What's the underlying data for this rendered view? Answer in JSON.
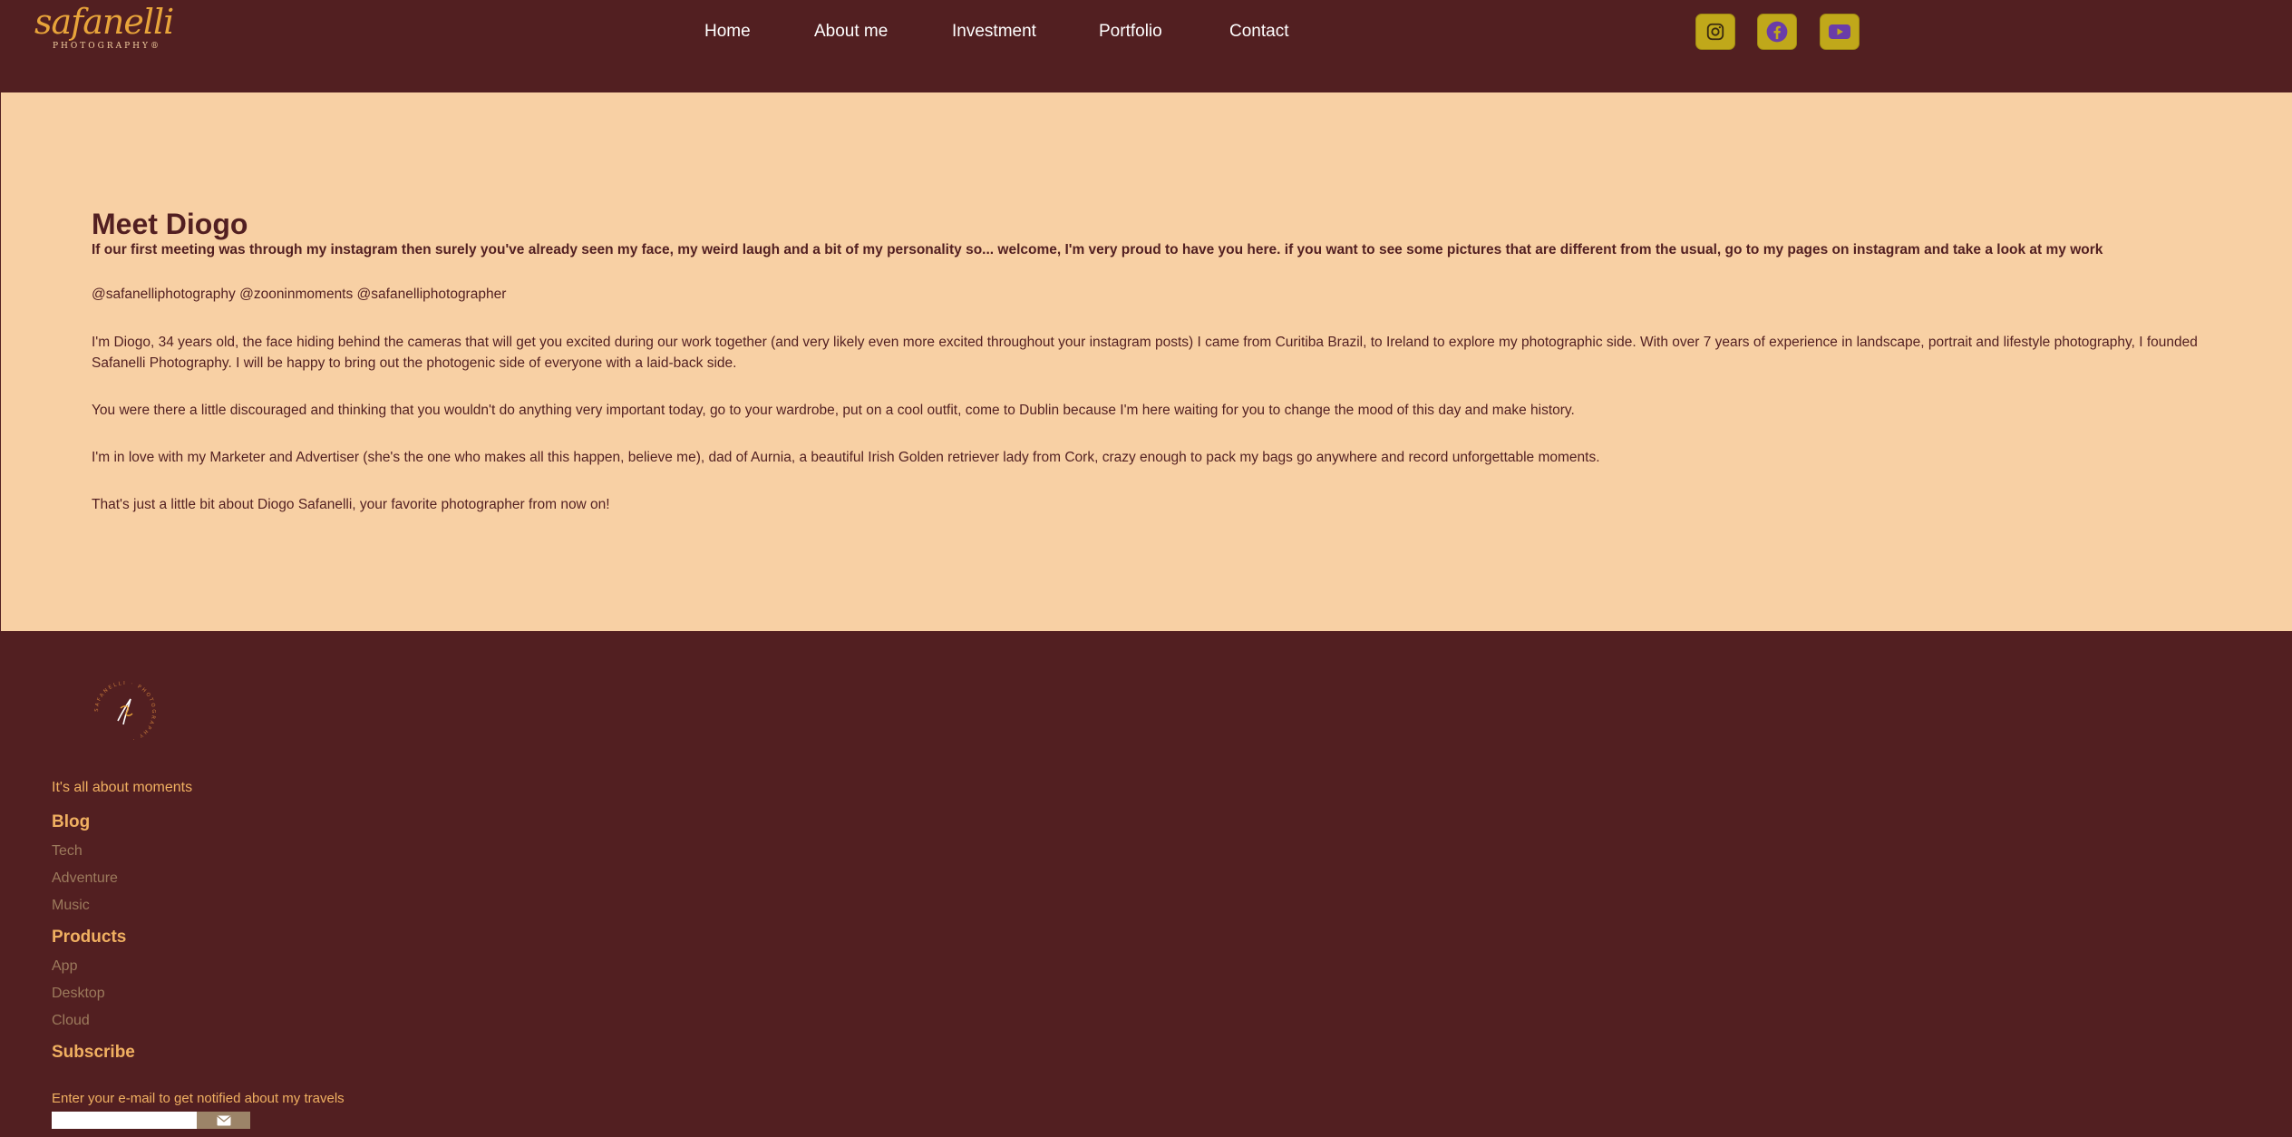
{
  "brand": {
    "script": "safanelli",
    "subtitle": "PHOTOGRAPHY®"
  },
  "nav": {
    "items": [
      {
        "label": "Home"
      },
      {
        "label": "About me"
      },
      {
        "label": "Investment"
      },
      {
        "label": "Portfolio"
      },
      {
        "label": "Contact"
      }
    ]
  },
  "social": {
    "items": [
      {
        "icon": "instagram-icon"
      },
      {
        "icon": "facebook-icon"
      },
      {
        "icon": "youtube-icon"
      }
    ],
    "button_color": "#c0a81a",
    "glyph_color": "#6a3ca8"
  },
  "about": {
    "title": "Meet Diogo",
    "intro": "If our first meeting was through my instagram then surely you've already seen my face, my weird laugh and a bit of my personality so... welcome, I'm very proud to have you here. if you want to see some pictures that are different from the usual, go to my pages on instagram and take a look at my work",
    "handles": "@safanelliphotography @zooninmoments @safanelliphotographer",
    "bio": "I'm Diogo, 34 years old, the face hiding behind the cameras that will get you excited during our work together (and very likely even more excited throughout your instagram posts) I came from Curitiba Brazil, to Ireland to explore my photographic side. With over 7 years of experience in landscape, portrait and lifestyle photography, I founded Safanelli Photography. I will be happy to bring out the photogenic side of everyone with a laid-back side.",
    "invite": "You were there a little discouraged and thinking that you wouldn't do anything very important today, go to your wardrobe, put on a cool outfit, come to Dublin because I'm here waiting for you to change the mood of this day and make history.",
    "personal": "I'm in love with my Marketer and Advertiser (she's the one who makes all this happen, believe me), dad of Aurnia, a beautiful Irish Golden retriever lady from Cork, crazy enough to pack my bags go anywhere and record unforgettable moments.",
    "closing": "That's just a little bit about Diogo Safanelli, your favorite photographer from now on!"
  },
  "footer": {
    "emblem_text": "SAFANELLI · PHOTOGRAPHY ·",
    "tagline": "It's all about moments",
    "blog": {
      "heading": "Blog",
      "links": [
        "Tech",
        "Adventure",
        "Music"
      ]
    },
    "products": {
      "heading": "Products",
      "links": [
        "App",
        "Desktop",
        "Cloud"
      ]
    },
    "subscribe": {
      "heading": "Subscribe",
      "text": "Enter your e-mail to get notified about my travels",
      "placeholder": ""
    }
  },
  "colors": {
    "maroon": "#521f21",
    "peach": "#f8d0a4",
    "gold": "#f0b061",
    "muted_link": "#9c7a5c"
  }
}
